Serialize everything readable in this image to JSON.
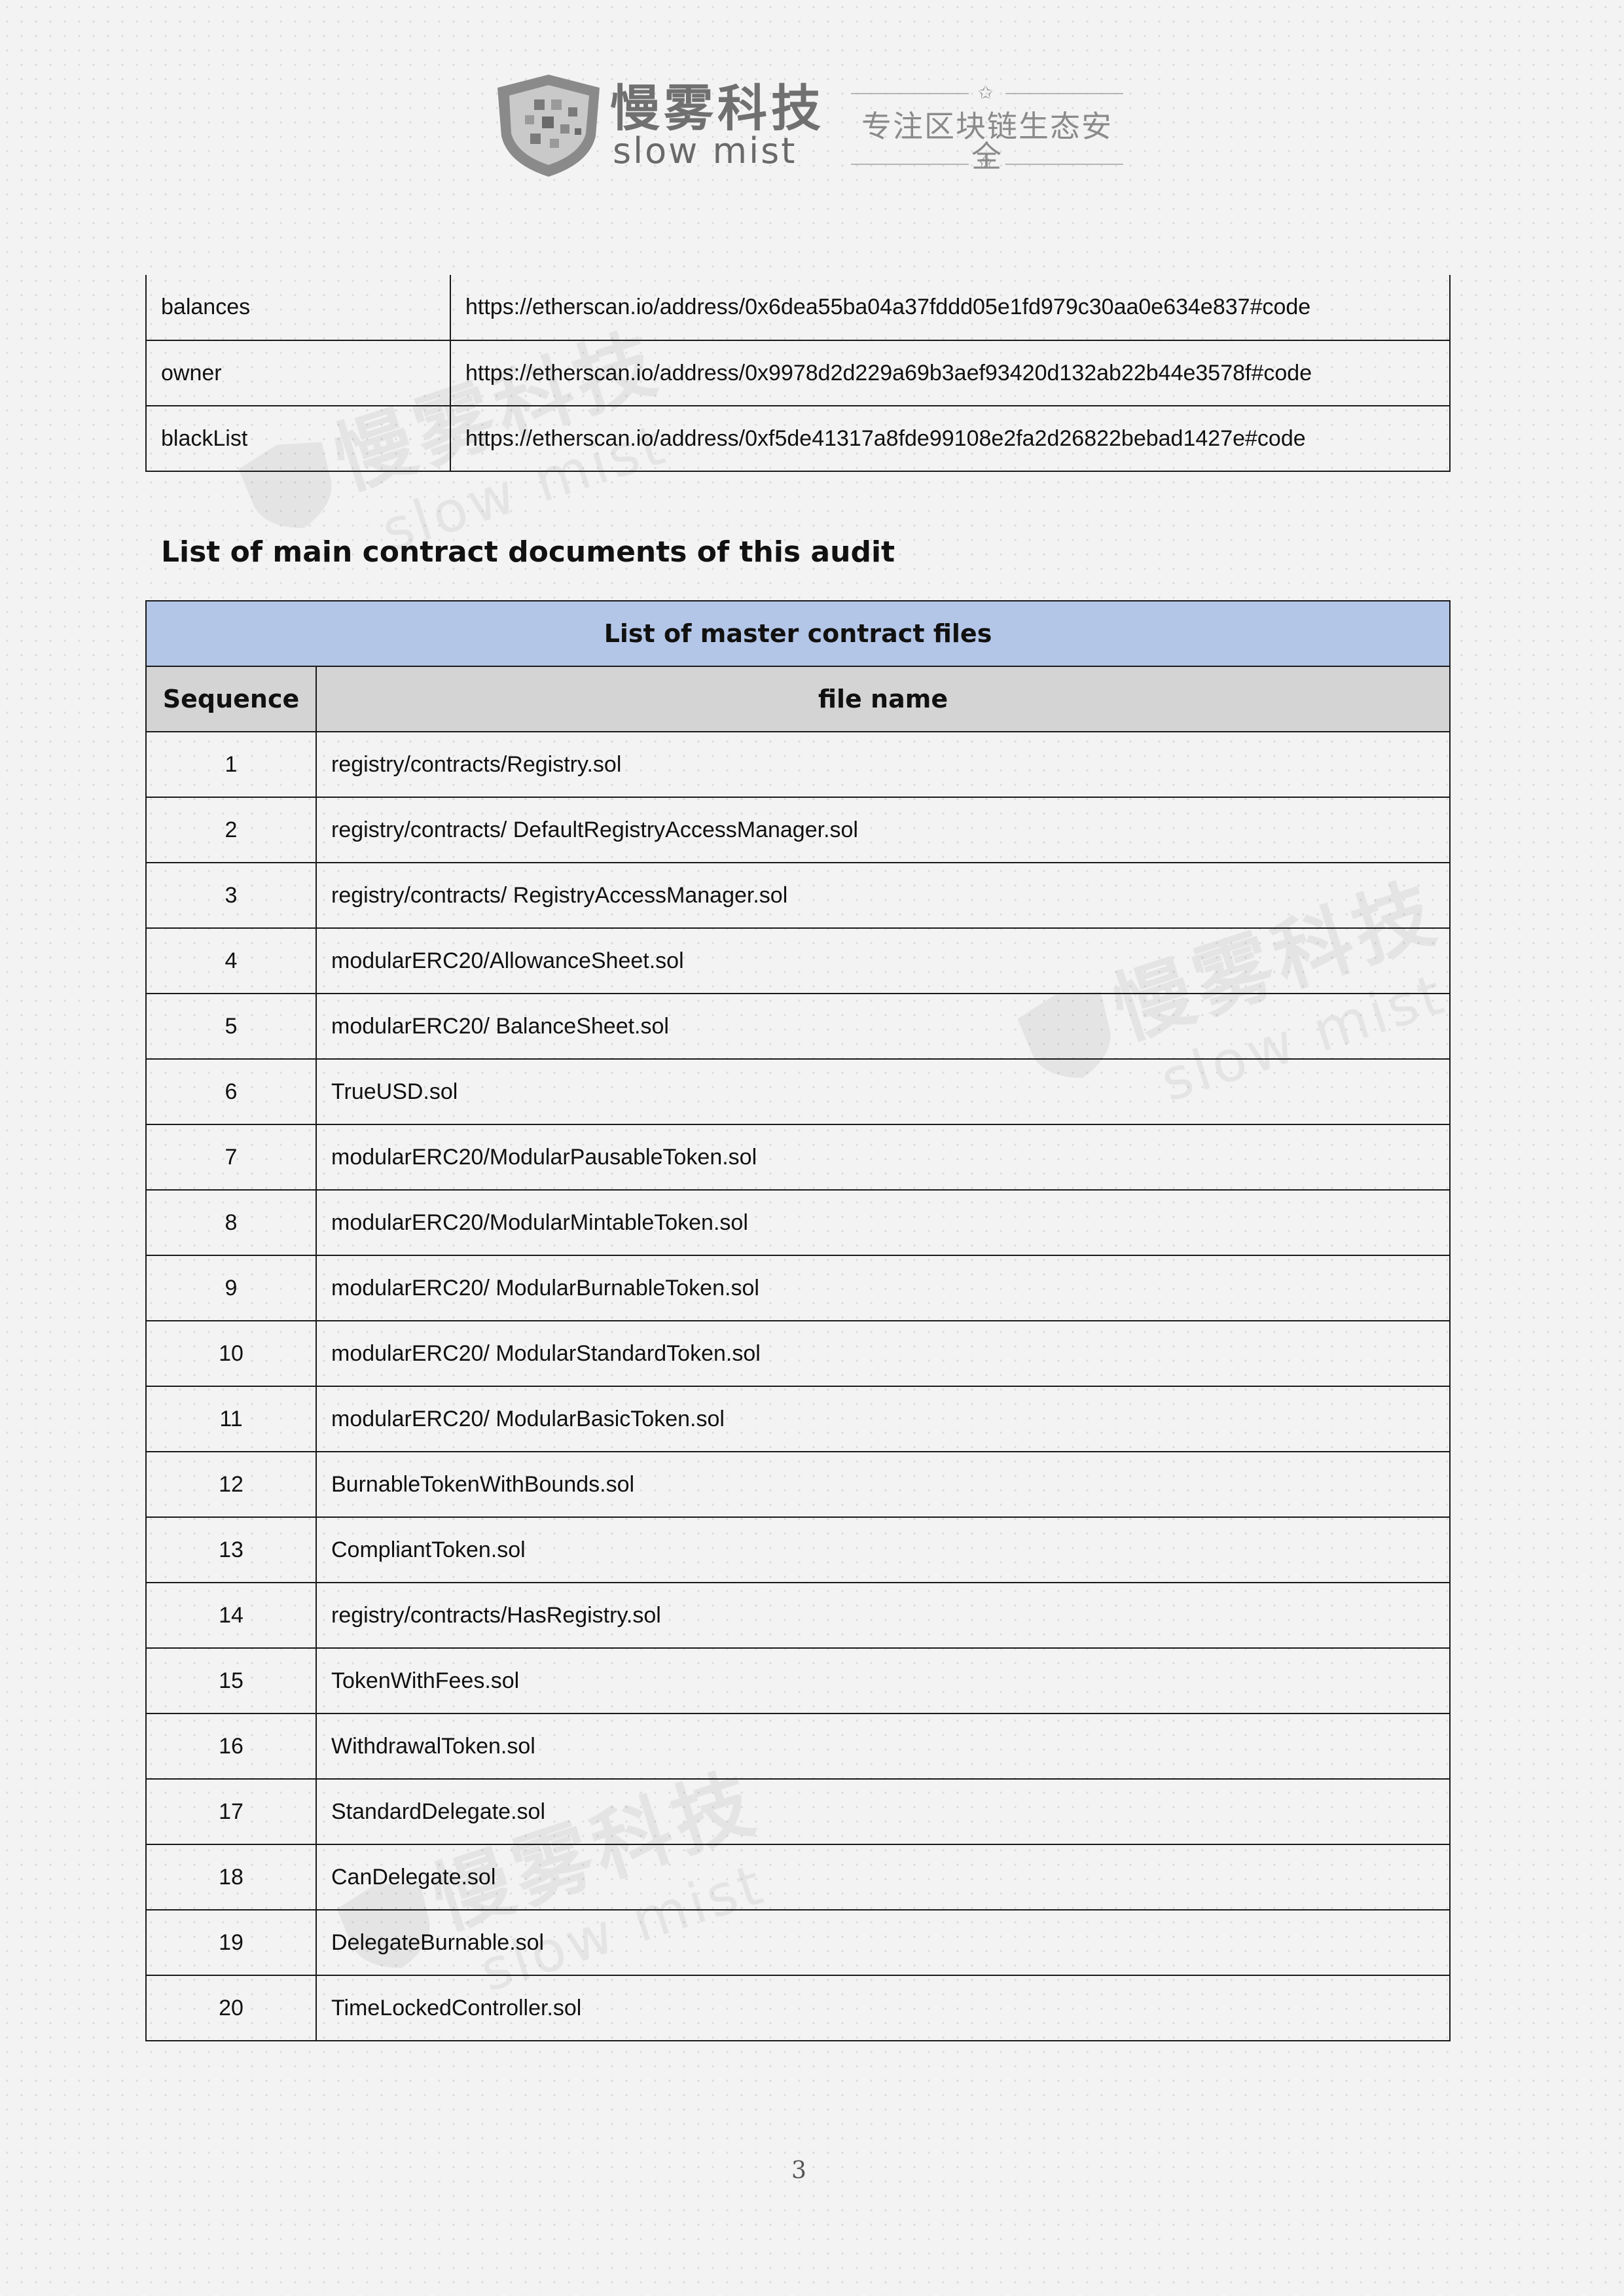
{
  "header": {
    "brand_cn": "慢雾科技",
    "brand_en": "slow mist",
    "slogan": "专注区块链生态安全",
    "logo_icon": "slowmist-shield-logo",
    "star_icon": "star-outline-icon"
  },
  "address_table": {
    "rows": [
      {
        "name": "balances",
        "url": "https://etherscan.io/address/0x6dea55ba04a37fddd05e1fd979c30aa0e634e837#code"
      },
      {
        "name": "owner",
        "url": "https://etherscan.io/address/0x9978d2d229a69b3aef93420d132ab22b44e3578f#code"
      },
      {
        "name": "blackList",
        "url": "https://etherscan.io/address/0xf5de41317a8fde99108e2fa2d26822bebad1427e#code"
      }
    ]
  },
  "section_title": "List of main contract documents of this audit",
  "files_table": {
    "caption": "List of master contract files",
    "header_color": "#b4c6e7",
    "columns": {
      "sequence": "Sequence",
      "file_name": "file name"
    },
    "rows": [
      {
        "seq": "1",
        "file": "registry/contracts/Registry.sol"
      },
      {
        "seq": "2",
        "file": "registry/contracts/ DefaultRegistryAccessManager.sol"
      },
      {
        "seq": "3",
        "file": "registry/contracts/ RegistryAccessManager.sol"
      },
      {
        "seq": "4",
        "file": "modularERC20/AllowanceSheet.sol"
      },
      {
        "seq": "5",
        "file": "modularERC20/ BalanceSheet.sol"
      },
      {
        "seq": "6",
        "file": "TrueUSD.sol"
      },
      {
        "seq": "7",
        "file": "modularERC20/ModularPausableToken.sol"
      },
      {
        "seq": "8",
        "file": "modularERC20/ModularMintableToken.sol"
      },
      {
        "seq": "9",
        "file": "modularERC20/ ModularBurnableToken.sol"
      },
      {
        "seq": "10",
        "file": "modularERC20/ ModularStandardToken.sol"
      },
      {
        "seq": "11",
        "file": "modularERC20/ ModularBasicToken.sol"
      },
      {
        "seq": "12",
        "file": "BurnableTokenWithBounds.sol"
      },
      {
        "seq": "13",
        "file": "CompliantToken.sol"
      },
      {
        "seq": "14",
        "file": "registry/contracts/HasRegistry.sol"
      },
      {
        "seq": "15",
        "file": "TokenWithFees.sol"
      },
      {
        "seq": "16",
        "file": "WithdrawalToken.sol"
      },
      {
        "seq": "17",
        "file": "StandardDelegate.sol"
      },
      {
        "seq": "18",
        "file": "CanDelegate.sol"
      },
      {
        "seq": "19",
        "file": "DelegateBurnable.sol"
      },
      {
        "seq": "20",
        "file": "TimeLockedController.sol"
      }
    ]
  },
  "page_number": "3"
}
